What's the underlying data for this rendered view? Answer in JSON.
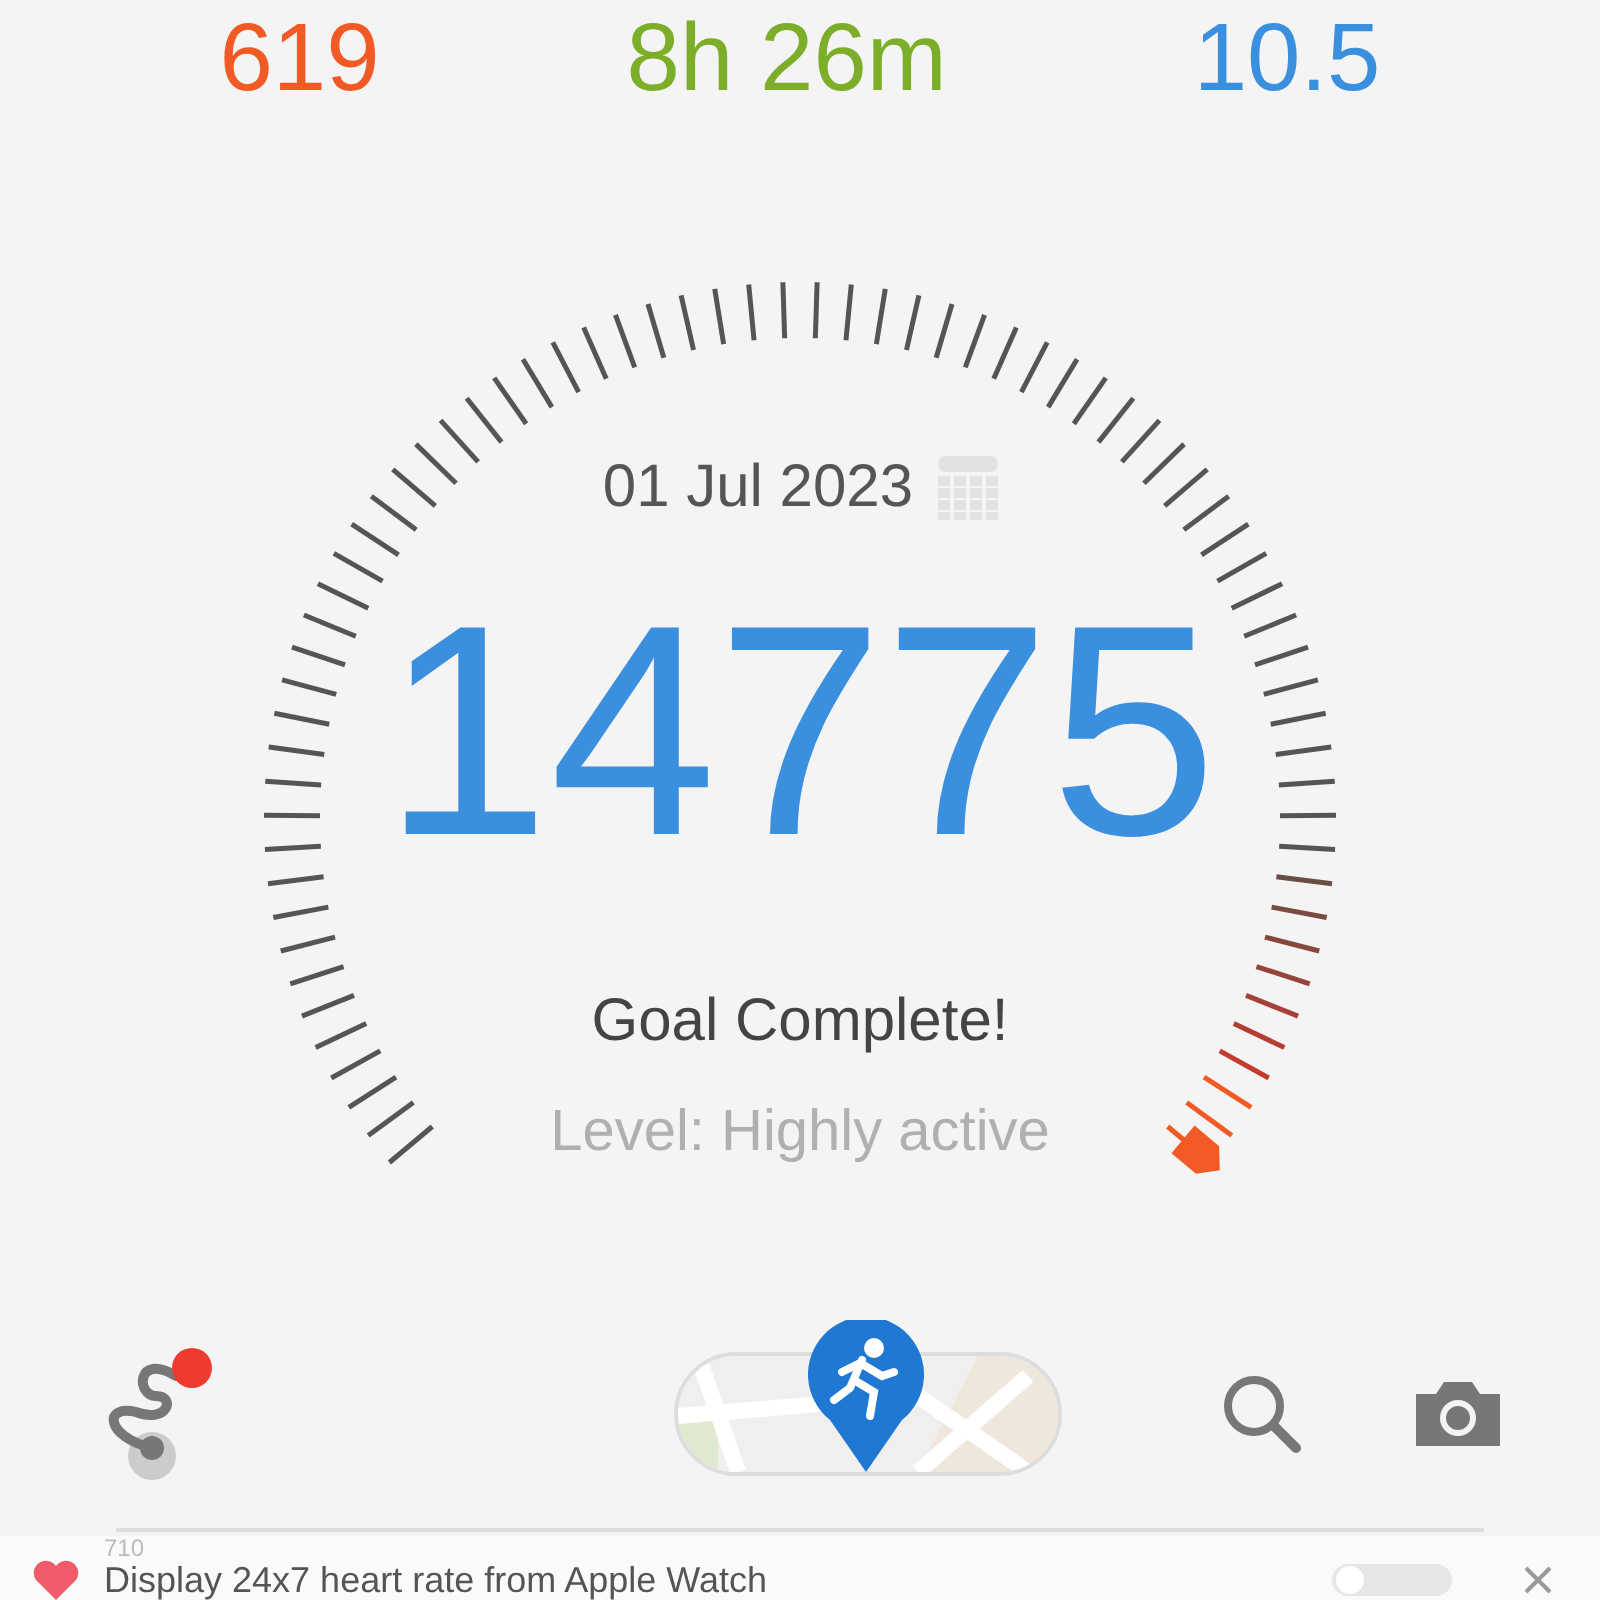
{
  "summary": [
    {
      "value": "619",
      "color": "#f15a24"
    },
    {
      "value": "8h 26m",
      "color": "#7cae2a"
    },
    {
      "value": "10.5",
      "color": "#3a8fde"
    }
  ],
  "gauge": {
    "date": "01 Jul 2023",
    "steps": "14775",
    "status": "Goal Complete!",
    "activity_level": "Level: Highly active"
  },
  "toolbar": {
    "route_badge": true
  },
  "banner": {
    "count": "710",
    "text": "Display 24x7 heart rate from Apple Watch",
    "on": false
  }
}
